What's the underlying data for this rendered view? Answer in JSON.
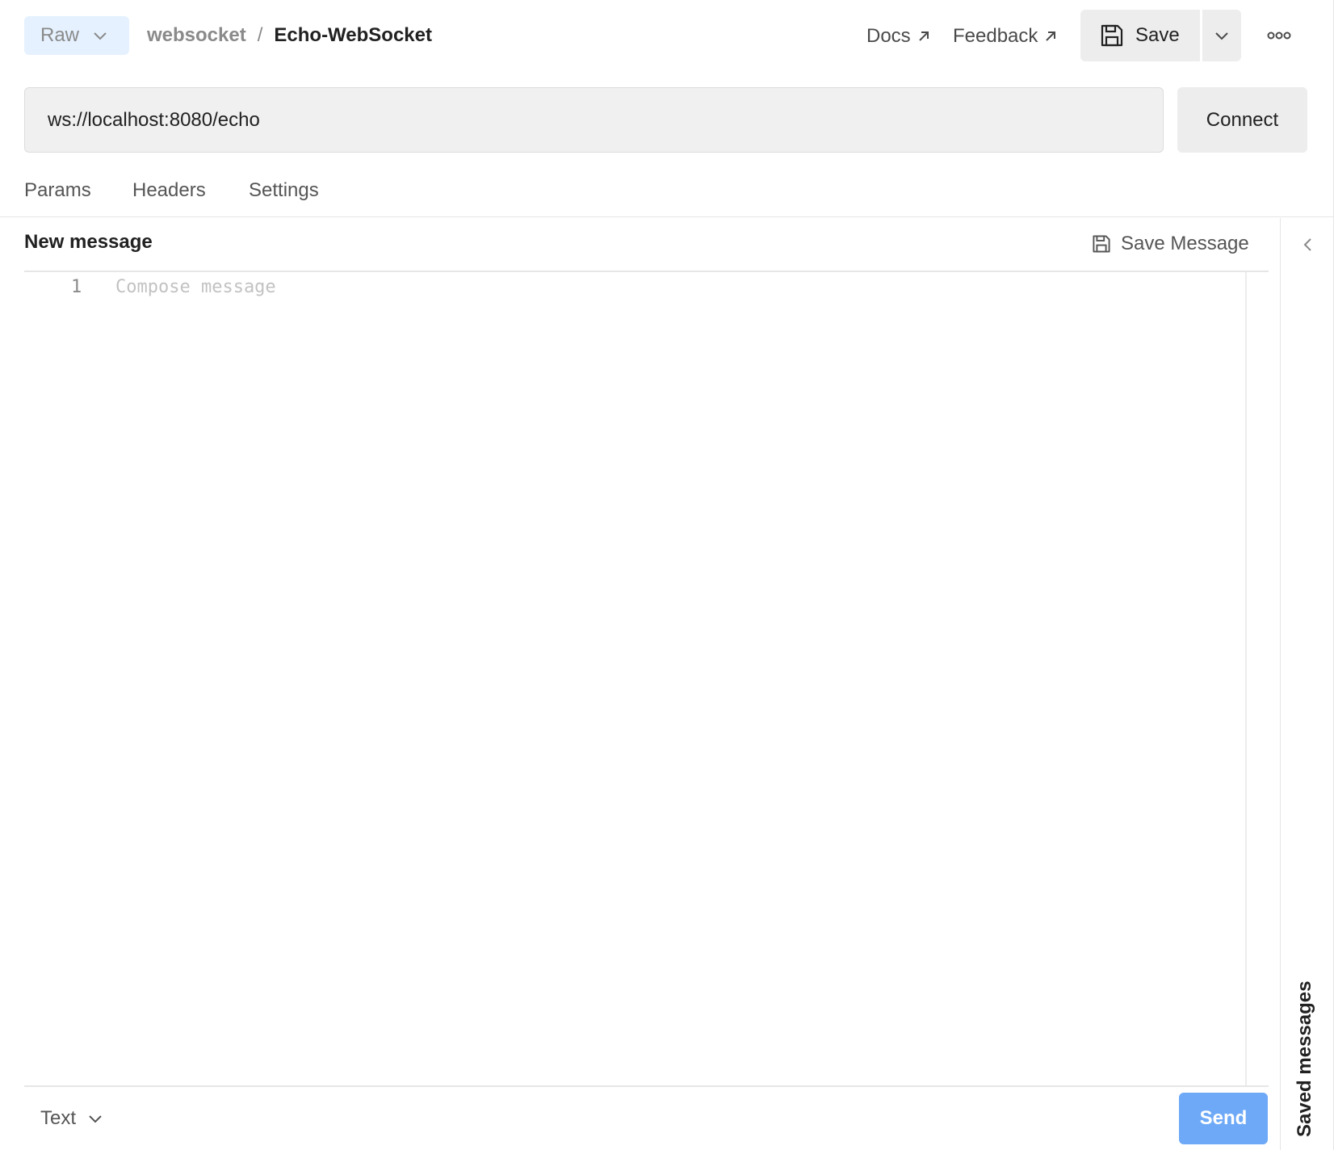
{
  "header": {
    "mode_select": {
      "value": "Raw"
    },
    "breadcrumb": {
      "parent": "websocket",
      "separator": "/",
      "current": "Echo-WebSocket"
    },
    "docs_link": "Docs",
    "feedback_link": "Feedback",
    "save_label": "Save",
    "icons": {
      "mode": "chevron-down-icon",
      "external": "arrow-up-right-icon",
      "save": "floppy-disk-icon",
      "save_menu": "chevron-down-icon",
      "more": "ellipsis-icon"
    }
  },
  "url_bar": {
    "value": "ws://localhost:8080/echo",
    "connect_label": "Connect"
  },
  "tabs": [
    {
      "label": "Params"
    },
    {
      "label": "Headers"
    },
    {
      "label": "Settings"
    }
  ],
  "message_panel": {
    "title": "New message",
    "save_message_label": "Save Message",
    "editor": {
      "line_numbers": [
        "1"
      ],
      "placeholder": "Compose message"
    },
    "format_select": {
      "value": "Text"
    },
    "send_label": "Send"
  },
  "side_panel": {
    "label": "Saved messages",
    "collapse_icon": "chevron-left-icon"
  },
  "colors": {
    "accent_light": "#e5f1ff",
    "send_button": "#6ea9f7",
    "button_bg": "#ededed",
    "input_bg": "#f0f0f0"
  }
}
